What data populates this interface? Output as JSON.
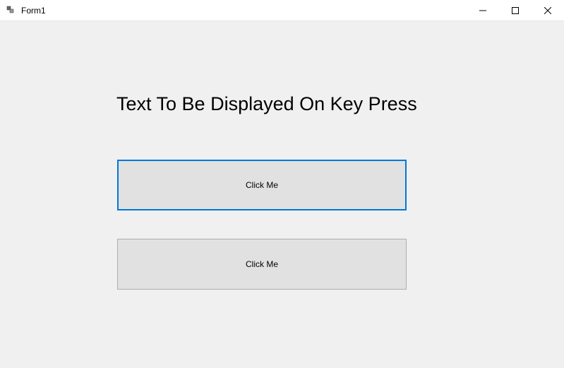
{
  "window": {
    "title": "Form1"
  },
  "content": {
    "label_text": "Text To Be Displayed On Key Press",
    "button1_label": "Click Me",
    "button2_label": "Click Me"
  }
}
